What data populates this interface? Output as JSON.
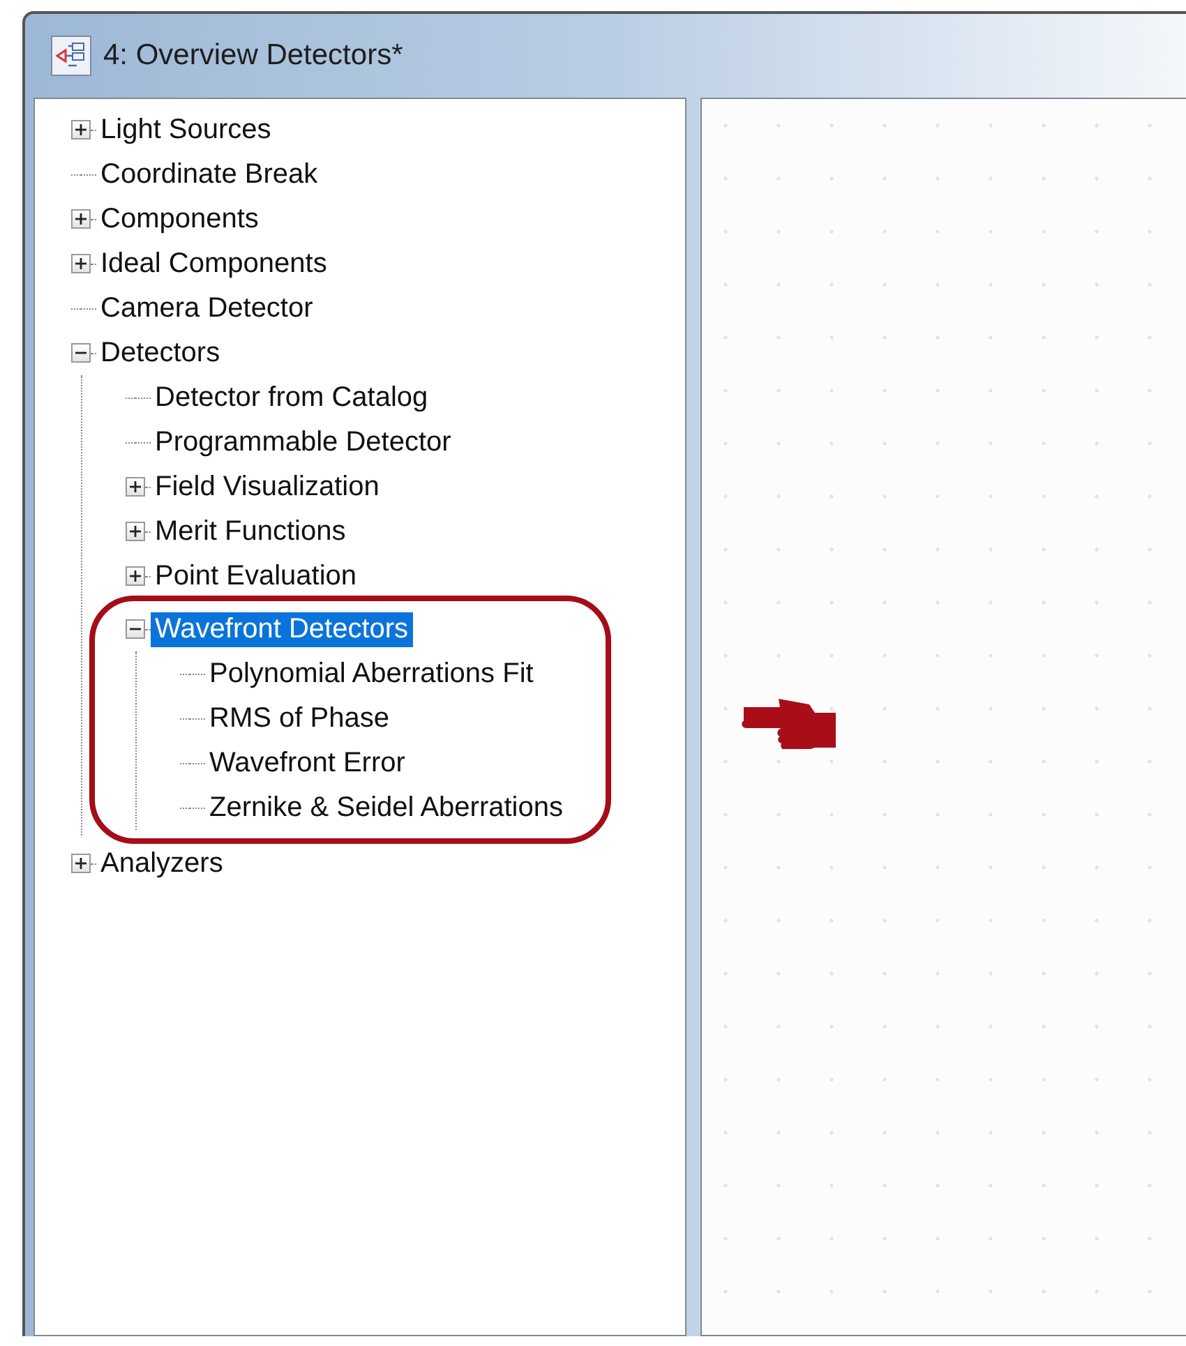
{
  "window": {
    "title": "4: Overview Detectors*"
  },
  "tree": [
    {
      "label": "Light Sources",
      "kind": "folder",
      "expanded": false,
      "selected": false,
      "annotated": false
    },
    {
      "label": "Coordinate Break",
      "kind": "leaf",
      "selected": false,
      "annotated": false
    },
    {
      "label": "Components",
      "kind": "folder",
      "expanded": false,
      "selected": false,
      "annotated": false
    },
    {
      "label": "Ideal Components",
      "kind": "folder",
      "expanded": false,
      "selected": false,
      "annotated": false
    },
    {
      "label": "Camera Detector",
      "kind": "leaf",
      "selected": false,
      "annotated": false
    },
    {
      "label": "Detectors",
      "kind": "folder",
      "expanded": true,
      "selected": false,
      "annotated": false,
      "children": [
        {
          "label": "Detector from Catalog",
          "kind": "leaf",
          "selected": false,
          "annotated": false
        },
        {
          "label": "Programmable Detector",
          "kind": "leaf",
          "selected": false,
          "annotated": false
        },
        {
          "label": "Field Visualization",
          "kind": "folder",
          "expanded": false,
          "selected": false,
          "annotated": false
        },
        {
          "label": "Merit Functions",
          "kind": "folder",
          "expanded": false,
          "selected": false,
          "annotated": false
        },
        {
          "label": "Point Evaluation",
          "kind": "folder",
          "expanded": false,
          "selected": false,
          "annotated": false
        },
        {
          "label": "Wavefront Detectors",
          "kind": "folder",
          "expanded": true,
          "selected": true,
          "annotated": true,
          "children": [
            {
              "label": "Polynomial Aberrations Fit",
              "kind": "leaf",
              "selected": false,
              "annotated": false
            },
            {
              "label": "RMS of Phase",
              "kind": "leaf",
              "selected": false,
              "annotated": false
            },
            {
              "label": "Wavefront Error",
              "kind": "leaf",
              "selected": false,
              "annotated": false
            },
            {
              "label": "Zernike & Seidel Aberrations",
              "kind": "leaf",
              "selected": false,
              "annotated": false
            }
          ]
        }
      ]
    },
    {
      "label": "Analyzers",
      "kind": "folder",
      "expanded": false,
      "selected": false,
      "annotated": false
    }
  ]
}
